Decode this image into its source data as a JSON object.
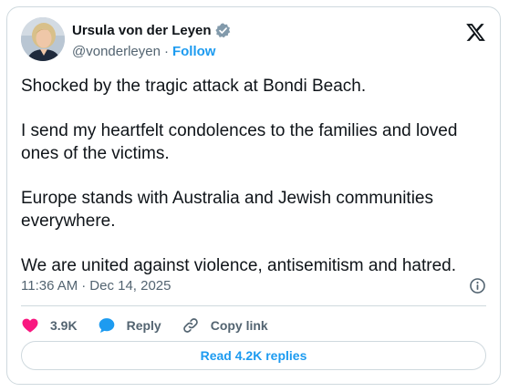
{
  "author": {
    "name": "Ursula von der Leyen",
    "handle": "@vonderleyen",
    "separator": "·",
    "follow_label": "Follow",
    "avatar_icon": "avatar-portrait",
    "verified_icon": "verified-badge-icon",
    "verified_color": "#829aab"
  },
  "platform_icon": "x-logo-icon",
  "tweet": {
    "paragraphs": [
      "Shocked by the tragic attack at Bondi Beach.",
      "I send my heartfelt condolences to the families and loved ones of the victims.",
      "Europe stands with Australia and Jewish communities everywhere.",
      "We are united against violence, antisemitism and hatred."
    ]
  },
  "meta": {
    "time": "11:36 AM",
    "separator": "·",
    "date": "Dec 14, 2025",
    "info_icon": "info-icon"
  },
  "actions": {
    "likes_count": "3.9K",
    "like_icon": "heart-icon",
    "like_color": "#f91880",
    "reply_label": "Reply",
    "reply_icon": "speech-bubble-icon",
    "reply_color": "#1d9bf0",
    "copy_label": "Copy link",
    "copy_icon": "link-icon"
  },
  "read_replies_label": "Read 4.2K replies",
  "colors": {
    "text": "#0f1419",
    "secondary": "#536471",
    "accent": "#1d9bf0",
    "border": "#cfd9de"
  }
}
